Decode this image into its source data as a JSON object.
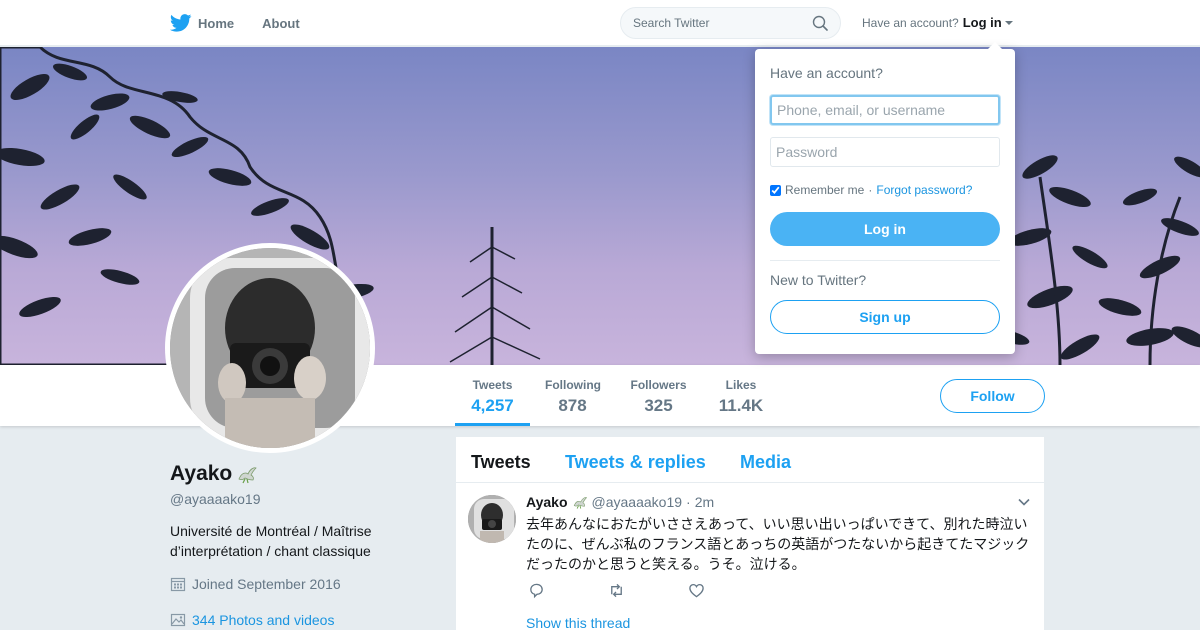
{
  "nav": {
    "home_label": "Home",
    "about_label": "About",
    "search_placeholder": "Search Twitter",
    "have_account_text": "Have an account?",
    "login_label": "Log in",
    "brand_color": "#1da1f2"
  },
  "login_dropdown": {
    "title": "Have an account?",
    "username_placeholder": "Phone, email, or username",
    "password_placeholder": "Password",
    "remember_label": "Remember me",
    "separator": "·",
    "forgot_label": "Forgot password?",
    "login_button": "Log in",
    "new_text": "New to Twitter?",
    "signup_button": "Sign up"
  },
  "profile": {
    "name": "Ayako",
    "handle": "@ayaaaako19",
    "bio": "Université de Montréal / Maîtrise d’interprétation / chant classique",
    "joined": "Joined September 2016",
    "media_link": "344 Photos and videos",
    "follow_label": "Follow"
  },
  "stats": [
    {
      "label": "Tweets",
      "value": "4,257"
    },
    {
      "label": "Following",
      "value": "878"
    },
    {
      "label": "Followers",
      "value": "325"
    },
    {
      "label": "Likes",
      "value": "11.4K"
    }
  ],
  "tabs": [
    {
      "label": "Tweets"
    },
    {
      "label": "Tweets & replies"
    },
    {
      "label": "Media"
    }
  ],
  "tweet": {
    "name": "Ayako",
    "handle": "@ayaaaako19",
    "dot": "·",
    "time": "2m",
    "text": "去年あんなにおたがいささえあって、いい思い出いっぱいできて、別れた時泣いたのに、ぜんぶ私のフランス語とあっちの英語がつたないから起きてたマジックだったのかと思うと笑える。うそ。泣ける。",
    "show_thread": "Show this thread"
  }
}
